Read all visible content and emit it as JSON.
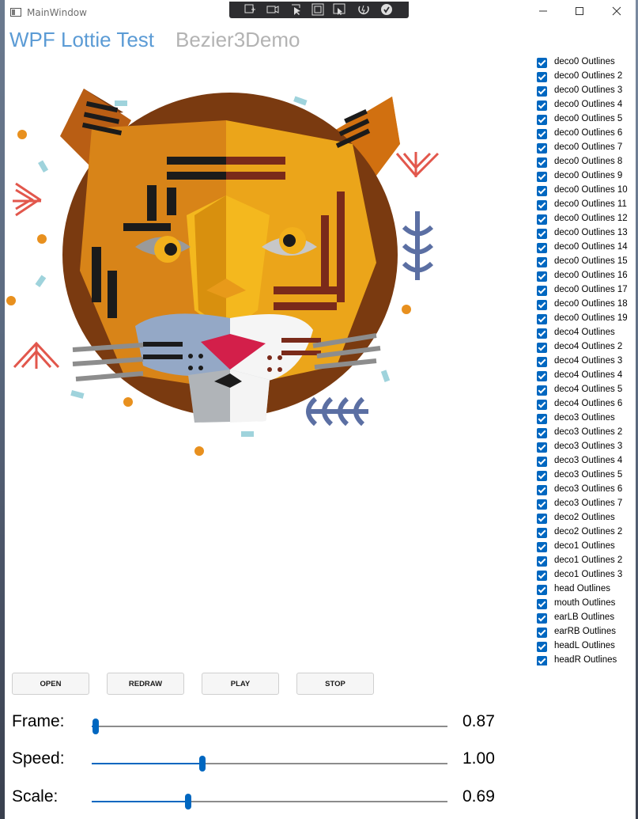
{
  "window": {
    "title": "MainWindow",
    "caption_buttons": [
      "minimize-icon",
      "maximize-icon",
      "close-icon"
    ],
    "debug_toolbar_icons": [
      "live-visual-tree-icon",
      "track-focus-icon",
      "select-element-icon",
      "display-layout-adorners-icon",
      "preview-selection-icon",
      "hot-reload-icon",
      "binding-check-icon"
    ]
  },
  "header": {
    "title": "WPF Lottie Test",
    "subtitle": "Bezier3Demo",
    "title_color": "#5b9bd5",
    "subtitle_color": "#b3b3b3"
  },
  "layers": [
    {
      "label": "deco0 Outlines",
      "checked": true
    },
    {
      "label": "deco0 Outlines 2",
      "checked": true
    },
    {
      "label": "deco0 Outlines 3",
      "checked": true
    },
    {
      "label": "deco0 Outlines 4",
      "checked": true
    },
    {
      "label": "deco0 Outlines 5",
      "checked": true
    },
    {
      "label": "deco0 Outlines 6",
      "checked": true
    },
    {
      "label": "deco0 Outlines 7",
      "checked": true
    },
    {
      "label": "deco0 Outlines 8",
      "checked": true
    },
    {
      "label": "deco0 Outlines 9",
      "checked": true
    },
    {
      "label": "deco0 Outlines 10",
      "checked": true
    },
    {
      "label": "deco0 Outlines 11",
      "checked": true
    },
    {
      "label": "deco0 Outlines 12",
      "checked": true
    },
    {
      "label": "deco0 Outlines 13",
      "checked": true
    },
    {
      "label": "deco0 Outlines 14",
      "checked": true
    },
    {
      "label": "deco0 Outlines 15",
      "checked": true
    },
    {
      "label": "deco0 Outlines 16",
      "checked": true
    },
    {
      "label": "deco0 Outlines 17",
      "checked": true
    },
    {
      "label": "deco0 Outlines 18",
      "checked": true
    },
    {
      "label": "deco0 Outlines 19",
      "checked": true
    },
    {
      "label": "deco4 Outlines",
      "checked": true
    },
    {
      "label": "deco4 Outlines 2",
      "checked": true
    },
    {
      "label": "deco4 Outlines 3",
      "checked": true
    },
    {
      "label": "deco4 Outlines 4",
      "checked": true
    },
    {
      "label": "deco4 Outlines 5",
      "checked": true
    },
    {
      "label": "deco4 Outlines 6",
      "checked": true
    },
    {
      "label": "deco3 Outlines",
      "checked": true
    },
    {
      "label": "deco3 Outlines 2",
      "checked": true
    },
    {
      "label": "deco3 Outlines 3",
      "checked": true
    },
    {
      "label": "deco3 Outlines 4",
      "checked": true
    },
    {
      "label": "deco3 Outlines 5",
      "checked": true
    },
    {
      "label": "deco3 Outlines 6",
      "checked": true
    },
    {
      "label": "deco3 Outlines 7",
      "checked": true
    },
    {
      "label": "deco2 Outlines",
      "checked": true
    },
    {
      "label": "deco2 Outlines 2",
      "checked": true
    },
    {
      "label": "deco1 Outlines",
      "checked": true
    },
    {
      "label": "deco1 Outlines 2",
      "checked": true
    },
    {
      "label": "deco1 Outlines 3",
      "checked": true
    },
    {
      "label": "head Outlines",
      "checked": true
    },
    {
      "label": "mouth Outlines",
      "checked": true
    },
    {
      "label": "earLB Outlines",
      "checked": true
    },
    {
      "label": "earRB Outlines",
      "checked": true
    },
    {
      "label": "headL Outlines",
      "checked": true
    },
    {
      "label": "headR Outlines",
      "checked": true
    }
  ],
  "buttons": {
    "open": "OPEN",
    "redraw": "REDRAW",
    "play": "PLAY",
    "stop": "STOP"
  },
  "sliders": {
    "frame": {
      "label": "Frame:",
      "value": "0.87",
      "fraction": 0.01
    },
    "speed": {
      "label": "Speed:",
      "value": "1.00",
      "fraction": 0.31
    },
    "scale": {
      "label": "Scale:",
      "value": "0.69",
      "fraction": 0.27
    }
  },
  "accent_color": "#0067c0"
}
